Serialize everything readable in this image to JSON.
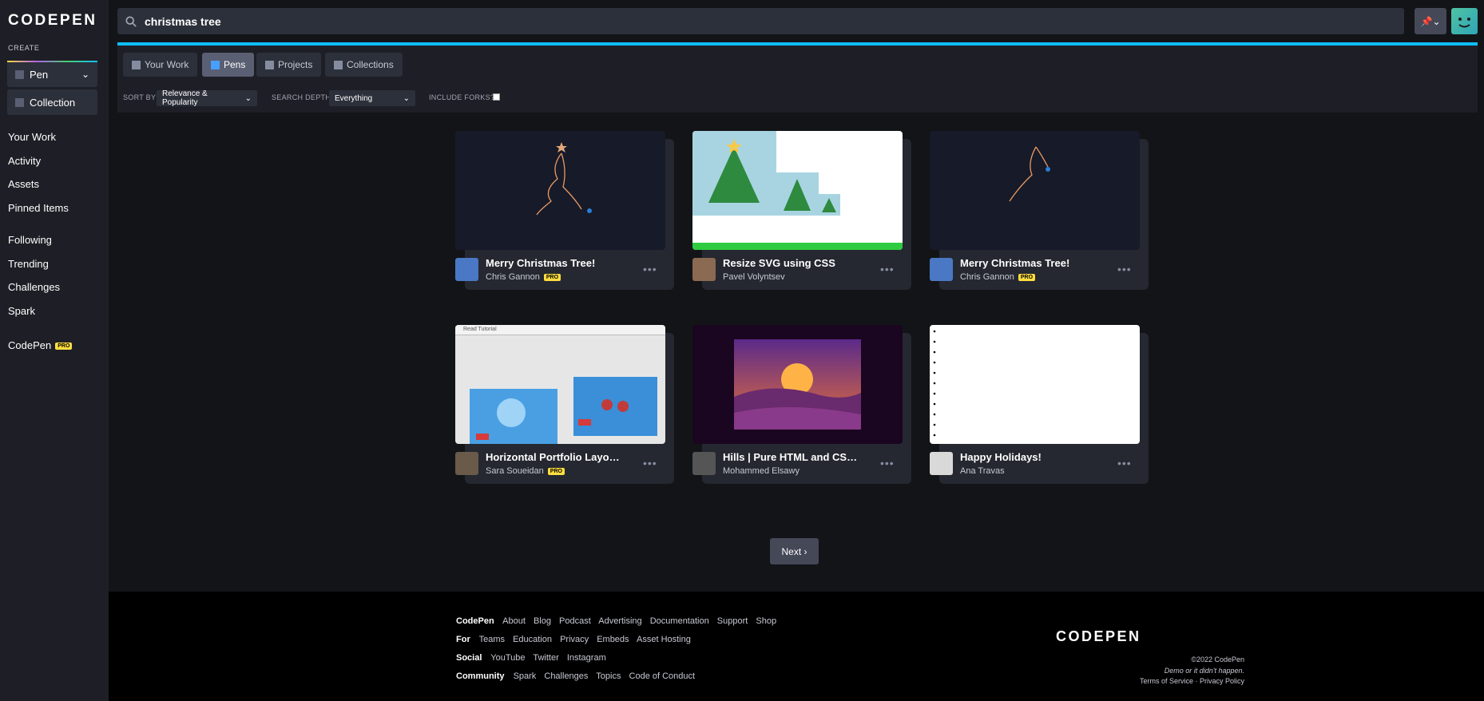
{
  "app": {
    "logo": "CODEPEN"
  },
  "sidebar": {
    "create_label": "CREATE",
    "pen_label": "Pen",
    "collection_label": "Collection",
    "nav": [
      "Your Work",
      "Activity",
      "Assets",
      "Pinned Items"
    ],
    "nav2": [
      "Following",
      "Trending",
      "Challenges",
      "Spark"
    ],
    "codepen_pro": "CodePen",
    "pro_badge": "PRO"
  },
  "search": {
    "value": "christmas tree"
  },
  "tabs": [
    {
      "label": "Your Work",
      "active": false
    },
    {
      "label": "Pens",
      "active": true
    },
    {
      "label": "Projects",
      "active": false
    },
    {
      "label": "Collections",
      "active": false
    }
  ],
  "filters": {
    "sort_label": "SORT BY",
    "sort_value": "Relevance & Popularity",
    "depth_label": "SEARCH DEPTH",
    "depth_value": "Everything",
    "forks_label": "INCLUDE FORKS?"
  },
  "pens": [
    {
      "title": "Merry Christmas Tree!",
      "author": "Chris Gannon",
      "pro": true
    },
    {
      "title": "Resize SVG using CSS",
      "author": "Pavel Volyntsev",
      "pro": false
    },
    {
      "title": "Merry Christmas Tree!",
      "author": "Chris Gannon",
      "pro": true
    },
    {
      "title": "Horizontal Portfolio Layout with Intersection Observer",
      "author": "Sara Soueidan",
      "pro": true,
      "thumb_text": "Read Tutorial"
    },
    {
      "title": "Hills | Pure HTML and CSS art",
      "author": "Mohammed Elsawy",
      "pro": false
    },
    {
      "title": "Happy Holidays!",
      "author": "Ana Travas",
      "pro": false
    }
  ],
  "pagination": {
    "next_label": "Next"
  },
  "footer": {
    "rows": [
      {
        "head": "CodePen",
        "links": [
          "About",
          "Blog",
          "Podcast",
          "Advertising",
          "Documentation",
          "Support",
          "Shop"
        ]
      },
      {
        "head": "For",
        "links": [
          "Teams",
          "Education",
          "Privacy",
          "Embeds",
          "Asset Hosting"
        ]
      },
      {
        "head": "Social",
        "links": [
          "YouTube",
          "Twitter",
          "Instagram"
        ]
      },
      {
        "head": "Community",
        "links": [
          "Spark",
          "Challenges",
          "Topics",
          "Code of Conduct"
        ]
      }
    ],
    "logo": "CODEPEN",
    "copyright": "©2022 CodePen",
    "tagline": "Demo or it didn't happen.",
    "legal": "Terms of Service · Privacy Policy"
  },
  "colors": {
    "accent": "#0ebeff",
    "pro": "#ffdd40",
    "bg": "#131417",
    "panel": "#1e1f26"
  }
}
